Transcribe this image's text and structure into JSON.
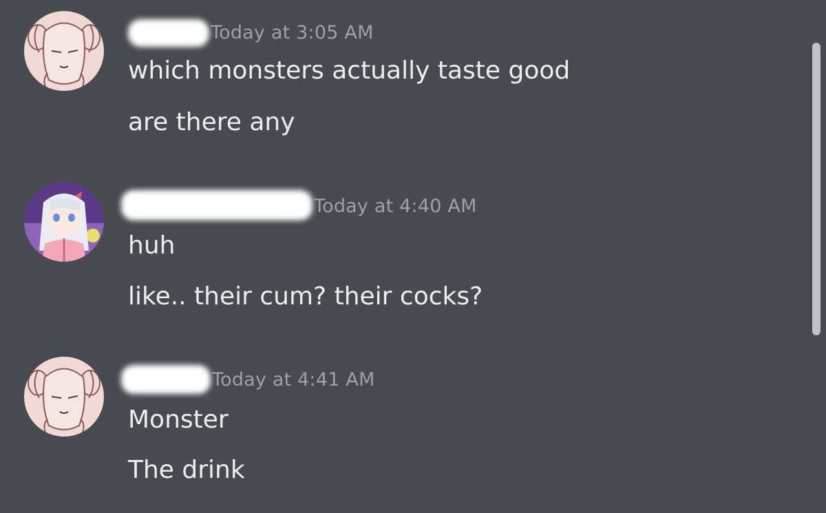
{
  "messages": [
    {
      "author_avatar": "sheep-girl-avatar",
      "timestamp": "Today at 3:05 AM",
      "lines": [
        "which monsters actually taste good",
        "are there any"
      ]
    },
    {
      "author_avatar": "white-hair-girl-avatar",
      "timestamp": "Today at 4:40 AM",
      "lines": [
        "huh",
        "like.. their cum? their cocks?"
      ]
    },
    {
      "author_avatar": "sheep-girl-avatar",
      "timestamp": "Today at 4:41 AM",
      "lines": [
        "Monster",
        "The drink"
      ]
    }
  ],
  "colors": {
    "background": "#474a4f",
    "text": "#eceef0",
    "timestamp": "#9ea2a8"
  }
}
